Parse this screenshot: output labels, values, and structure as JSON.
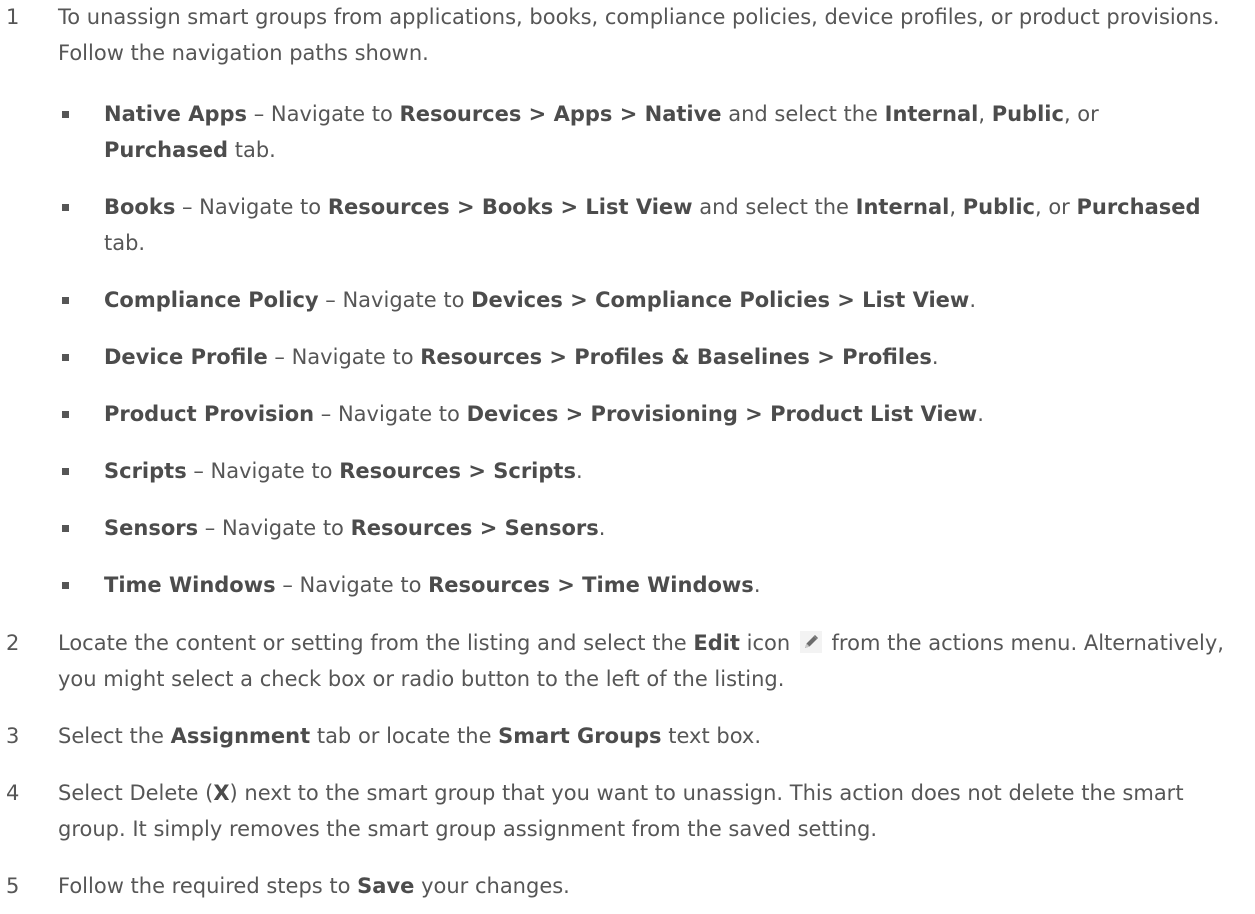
{
  "steps": [
    {
      "number": "1",
      "text": [
        {
          "t": "To unassign smart groups from applications, books, compliance policies, device profiles, or product provisions. Follow the navigation paths shown."
        }
      ],
      "bullets": [
        [
          {
            "t": "Native Apps",
            "b": true
          },
          {
            "t": " – Navigate to "
          },
          {
            "t": "Resources > Apps > Native",
            "b": true
          },
          {
            "t": " and select the "
          },
          {
            "t": "Internal",
            "b": true
          },
          {
            "t": ", "
          },
          {
            "t": "Public",
            "b": true
          },
          {
            "t": ", or "
          },
          {
            "t": "Purchased",
            "b": true
          },
          {
            "t": " tab."
          }
        ],
        [
          {
            "t": "Books",
            "b": true
          },
          {
            "t": " – Navigate to "
          },
          {
            "t": "Resources > Books > List View",
            "b": true
          },
          {
            "t": " and select the "
          },
          {
            "t": "Internal",
            "b": true
          },
          {
            "t": ", "
          },
          {
            "t": "Public",
            "b": true
          },
          {
            "t": ", or "
          },
          {
            "t": "Purchased",
            "b": true
          },
          {
            "t": " tab."
          }
        ],
        [
          {
            "t": "Compliance Policy",
            "b": true
          },
          {
            "t": " – Navigate to "
          },
          {
            "t": "Devices > Compliance Policies > List View",
            "b": true
          },
          {
            "t": "."
          }
        ],
        [
          {
            "t": "Device Profile",
            "b": true
          },
          {
            "t": " – Navigate to "
          },
          {
            "t": "Resources > Profiles & Baselines > Profiles",
            "b": true
          },
          {
            "t": "."
          }
        ],
        [
          {
            "t": "Product Provision",
            "b": true
          },
          {
            "t": " – Navigate to "
          },
          {
            "t": "Devices > Provisioning > Product List View",
            "b": true
          },
          {
            "t": "."
          }
        ],
        [
          {
            "t": "Scripts",
            "b": true
          },
          {
            "t": " – Navigate to "
          },
          {
            "t": "Resources > Scripts",
            "b": true
          },
          {
            "t": "."
          }
        ],
        [
          {
            "t": "Sensors",
            "b": true
          },
          {
            "t": " – Navigate to "
          },
          {
            "t": "Resources > Sensors",
            "b": true
          },
          {
            "t": "."
          }
        ],
        [
          {
            "t": "Time Windows",
            "b": true
          },
          {
            "t": " – Navigate to "
          },
          {
            "t": "Resources > Time Windows",
            "b": true
          },
          {
            "t": "."
          }
        ]
      ]
    },
    {
      "number": "2",
      "text": [
        {
          "t": "Locate the content or setting from the listing and select the "
        },
        {
          "t": "Edit",
          "b": true
        },
        {
          "t": " icon "
        },
        {
          "icon": "pencil-icon"
        },
        {
          "t": " from the actions menu. Alternatively, you might select a check box or radio button to the left of the listing."
        }
      ]
    },
    {
      "number": "3",
      "text": [
        {
          "t": "Select the "
        },
        {
          "t": "Assignment",
          "b": true
        },
        {
          "t": " tab or locate the "
        },
        {
          "t": "Smart Groups",
          "b": true
        },
        {
          "t": " text box."
        }
      ]
    },
    {
      "number": "4",
      "text": [
        {
          "t": "Select Delete ("
        },
        {
          "t": "X",
          "b": true
        },
        {
          "t": ") next to the smart group that you want to unassign. This action does not delete the smart group. It simply removes the smart group assignment from the saved setting."
        }
      ]
    },
    {
      "number": "5",
      "text": [
        {
          "t": "Follow the required steps to "
        },
        {
          "t": "Save",
          "b": true
        },
        {
          "t": " your changes."
        }
      ]
    }
  ]
}
